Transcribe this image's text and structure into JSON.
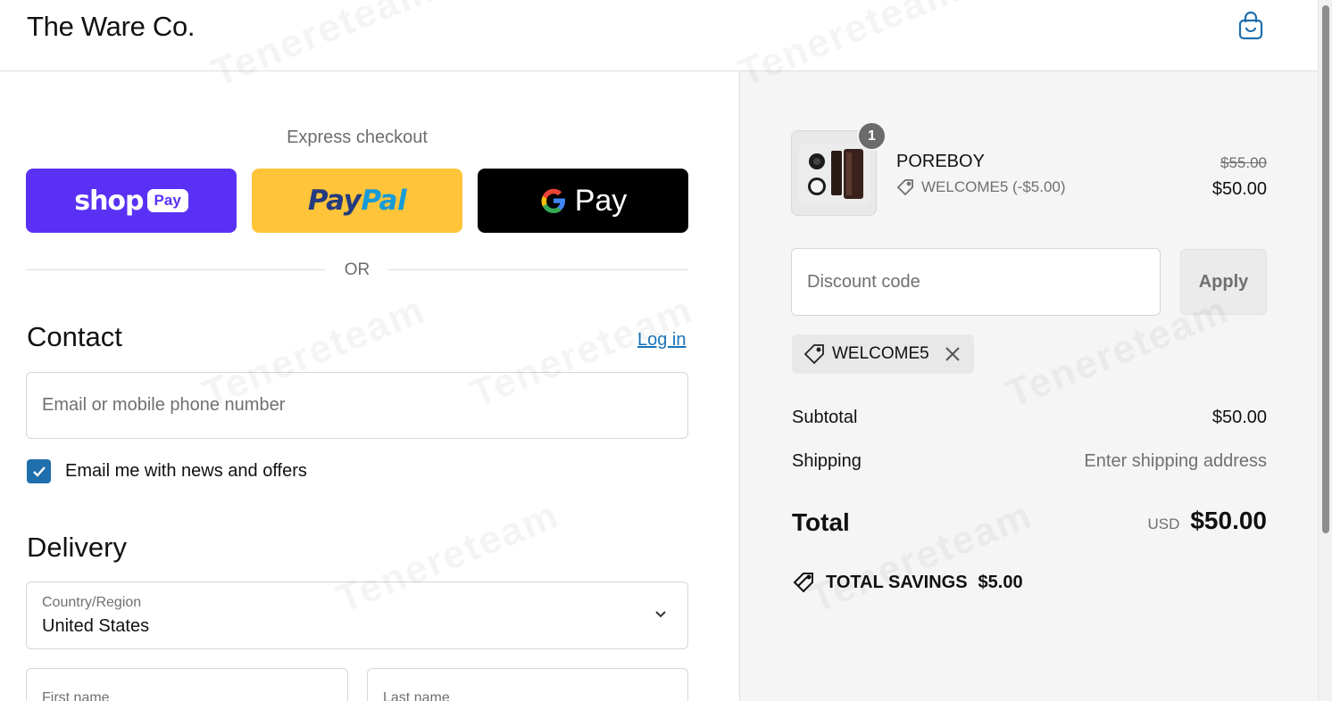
{
  "header": {
    "brand": "The Ware Co.",
    "cart_icon": "shopping-bag-icon"
  },
  "express": {
    "title": "Express checkout",
    "shop_pay": {
      "word": "shop",
      "pill": "Pay"
    },
    "paypal": {
      "part1": "Pay",
      "part2": "Pal"
    },
    "gpay": {
      "g": "G",
      "word": "Pay"
    },
    "or_label": "OR"
  },
  "contact": {
    "heading": "Contact",
    "login_label": "Log in",
    "email_placeholder": "Email or mobile phone number",
    "newsletter_label": "Email me with news and offers",
    "newsletter_checked": true
  },
  "delivery": {
    "heading": "Delivery",
    "country_label": "Country/Region",
    "country_value": "United States",
    "first_name_label": "First name",
    "last_name_label": "Last name"
  },
  "summary": {
    "item": {
      "quantity": "1",
      "name": "POREBOY",
      "discount_line": "WELCOME5 (-$5.00)",
      "original_price": "$55.00",
      "price": "$50.00"
    },
    "discount": {
      "placeholder": "Discount code",
      "apply_label": "Apply",
      "applied_code": "WELCOME5"
    },
    "subtotal_label": "Subtotal",
    "subtotal_value": "$50.00",
    "shipping_label": "Shipping",
    "shipping_value": "Enter shipping address",
    "total_label": "Total",
    "total_currency": "USD",
    "total_value": "$50.00",
    "savings_label": "TOTAL SAVINGS",
    "savings_value": "$5.00"
  },
  "watermark": "Tenereteam",
  "colors": {
    "shop_pay": "#5a31f4",
    "paypal": "#ffc439",
    "gpay": "#000000",
    "link": "#1a73b8",
    "checkbox": "#1f6fad",
    "summary_bg": "#f5f5f5"
  }
}
